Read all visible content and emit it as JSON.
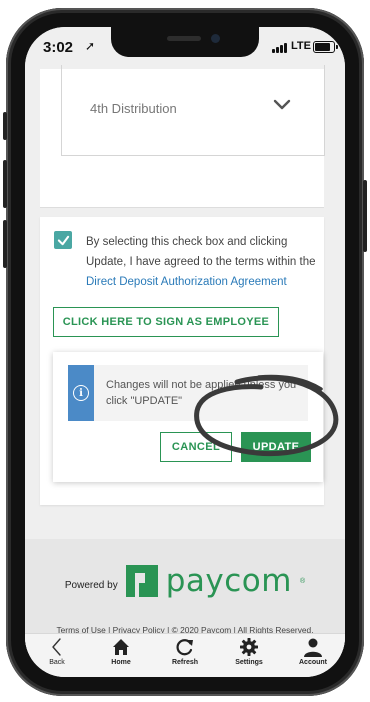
{
  "status_bar": {
    "time": "3:02",
    "network": "LTE"
  },
  "distribution": {
    "label": "4th Distribution"
  },
  "agreement": {
    "text": "By selecting this check box and clicking Update, I have agreed to the terms within the",
    "link": "Direct Deposit Authorization Agreement",
    "checked": true
  },
  "sign_button": {
    "label": "CLICK HERE TO SIGN AS EMPLOYEE"
  },
  "notice": {
    "message": "Changes will not be applied unless you click \"UPDATE\""
  },
  "actions": {
    "cancel_label": "CANCEL",
    "update_label": "UPDATE"
  },
  "footer": {
    "powered_by": "Powered by",
    "brand": "paycom",
    "legal": "Terms of Use | Privacy Policy | © 2020 Paycom | All Rights Reserved."
  },
  "tabbar": {
    "items": [
      {
        "label": "Back",
        "icon": "chevron-left-icon"
      },
      {
        "label": "Home",
        "icon": "home-icon"
      },
      {
        "label": "Refresh",
        "icon": "refresh-icon"
      },
      {
        "label": "Settings",
        "icon": "gear-icon"
      },
      {
        "label": "Account",
        "icon": "user-icon"
      }
    ]
  },
  "colors": {
    "brand_green": "#2a9454",
    "checkbox_teal": "#4aa7a3",
    "info_blue": "#4b8ac7",
    "link_blue": "#2a7ab8"
  }
}
